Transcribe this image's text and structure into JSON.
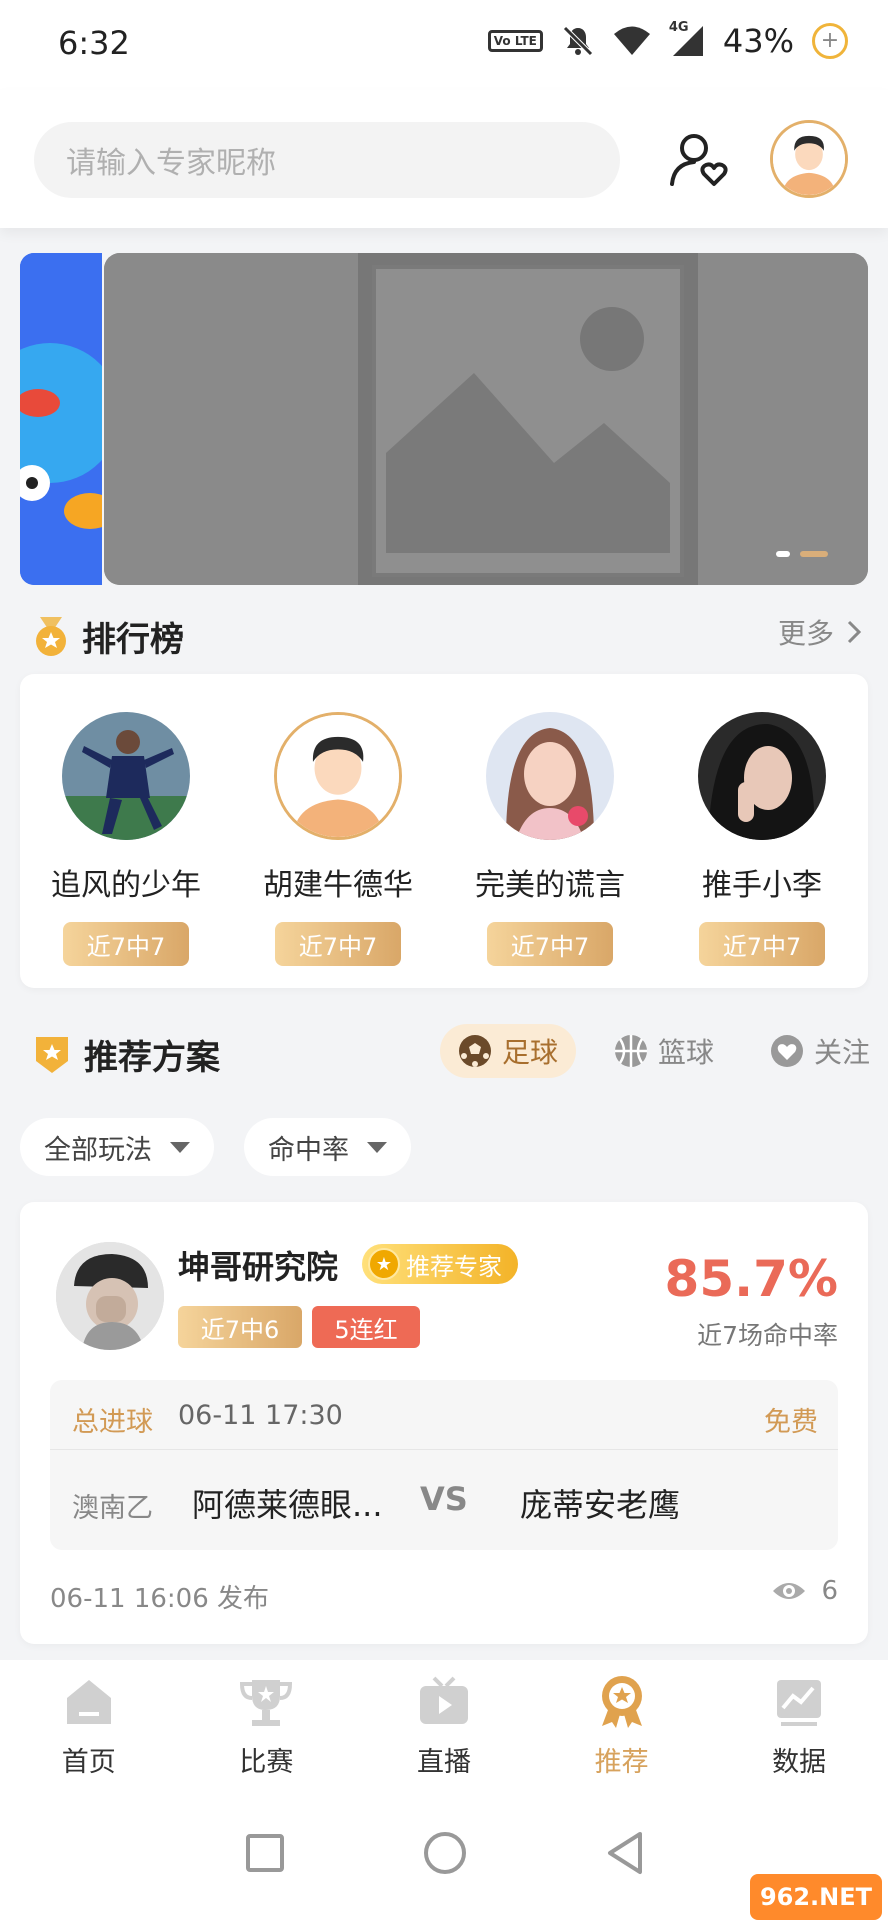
{
  "status_bar": {
    "time": "6:32",
    "volte": "Vo LTE",
    "network": "4G",
    "battery": "43%"
  },
  "header": {
    "search_placeholder": "请输入专家昵称"
  },
  "ranking": {
    "title": "排行榜",
    "more": "更多",
    "experts": [
      {
        "name": "追风的少年",
        "record": "近7中7"
      },
      {
        "name": "胡建牛德华",
        "record": "近7中7"
      },
      {
        "name": "完美的谎言",
        "record": "近7中7"
      },
      {
        "name": "推手小李",
        "record": "近7中7"
      }
    ]
  },
  "recommend": {
    "title": "推荐方案",
    "tabs": [
      "足球",
      "篮球",
      "关注"
    ],
    "active_tab": "足球",
    "filters": [
      "全部玩法",
      "命中率"
    ]
  },
  "scheme": {
    "expert_name": "坤哥研究院",
    "expert_tag": "推荐专家",
    "record": "近7中6",
    "streak": "5连红",
    "hit_rate": "85.7%",
    "hit_rate_label": "近7场命中率",
    "play_type": "总进球",
    "match_time": "06-11 17:30",
    "price": "免费",
    "league": "澳南乙",
    "home_team": "阿德莱德眼...",
    "vs": "VS",
    "away_team": "庞蒂安老鹰",
    "publish_time": "06-11 16:06 发布",
    "views": "6"
  },
  "bottom_nav": {
    "items": [
      "首页",
      "比赛",
      "直播",
      "推荐",
      "数据"
    ],
    "active": "推荐"
  },
  "watermark": "962.NET",
  "colors": {
    "accent": "#d7a25d",
    "hit_rate": "#ea6a58",
    "streak": "#ee6a55"
  }
}
